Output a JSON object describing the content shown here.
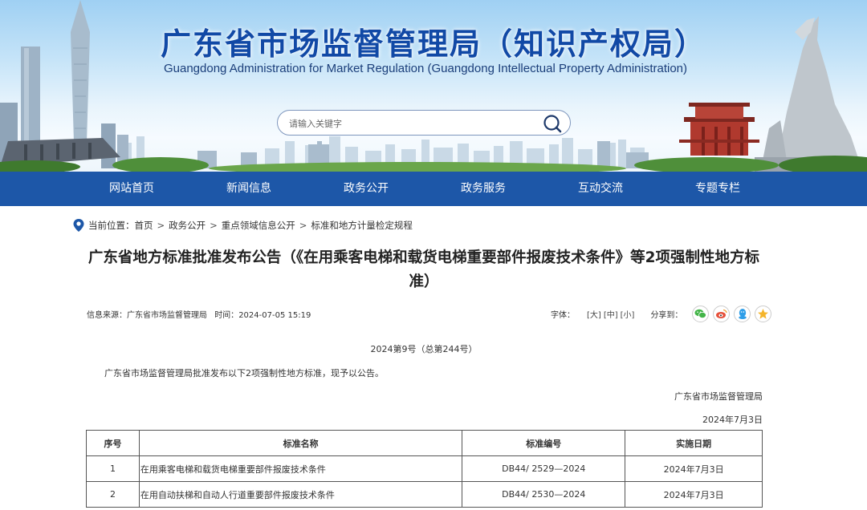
{
  "header": {
    "title": "广东省市场监督管理局（知识产权局）",
    "subtitle": "Guangdong Administration for Market Regulation (Guangdong Intellectual Property Administration)",
    "search_placeholder": "请输入关键字"
  },
  "nav": {
    "items": [
      "网站首页",
      "新闻信息",
      "政务公开",
      "政务服务",
      "互动交流",
      "专题专栏"
    ]
  },
  "breadcrumb": {
    "label": "当前位置：",
    "items": [
      "首页",
      "政务公开",
      "重点领域信息公开",
      "标准和地方计量检定规程"
    ],
    "separator": ">"
  },
  "article": {
    "title": "广东省地方标准批准发布公告（《在用乘客电梯和载货电梯重要部件报废技术条件》等2项强制性地方标准）",
    "meta": {
      "source_label": "信息来源：",
      "source": "广东省市场监督管理局",
      "time_label": "时间：",
      "time": "2024-07-05 15:19"
    },
    "font_label": "字体：",
    "font_sizes": [
      "[大]",
      "[中]",
      "[小]"
    ],
    "share_label": "分享到：",
    "share_icons": [
      "wechat-icon",
      "weibo-icon",
      "qq-icon",
      "qzone-icon"
    ],
    "doc_number": "2024第9号（总第244号）",
    "paragraph": "广东省市场监督管理局批准发布以下2项强制性地方标准，现予以公告。",
    "signer": "广东省市场监督管理局",
    "date": "2024年7月3日"
  },
  "table": {
    "headers": [
      "序号",
      "标准名称",
      "标准编号",
      "实施日期"
    ],
    "rows": [
      [
        "1",
        "在用乘客电梯和载货电梯重要部件报废技术条件",
        "DB44/ 2529—2024",
        "2024年7月3日"
      ],
      [
        "2",
        "在用自动扶梯和自动人行道重要部件报废技术条件",
        "DB44/ 2530—2024",
        "2024年7月3日"
      ]
    ]
  },
  "colors": {
    "brand_blue": "#1149a6",
    "nav_blue": "#1d57a8",
    "wechat": "#44b549",
    "weibo": "#e6503a",
    "qq": "#2e9ee8",
    "qzone": "#f5b52b"
  }
}
